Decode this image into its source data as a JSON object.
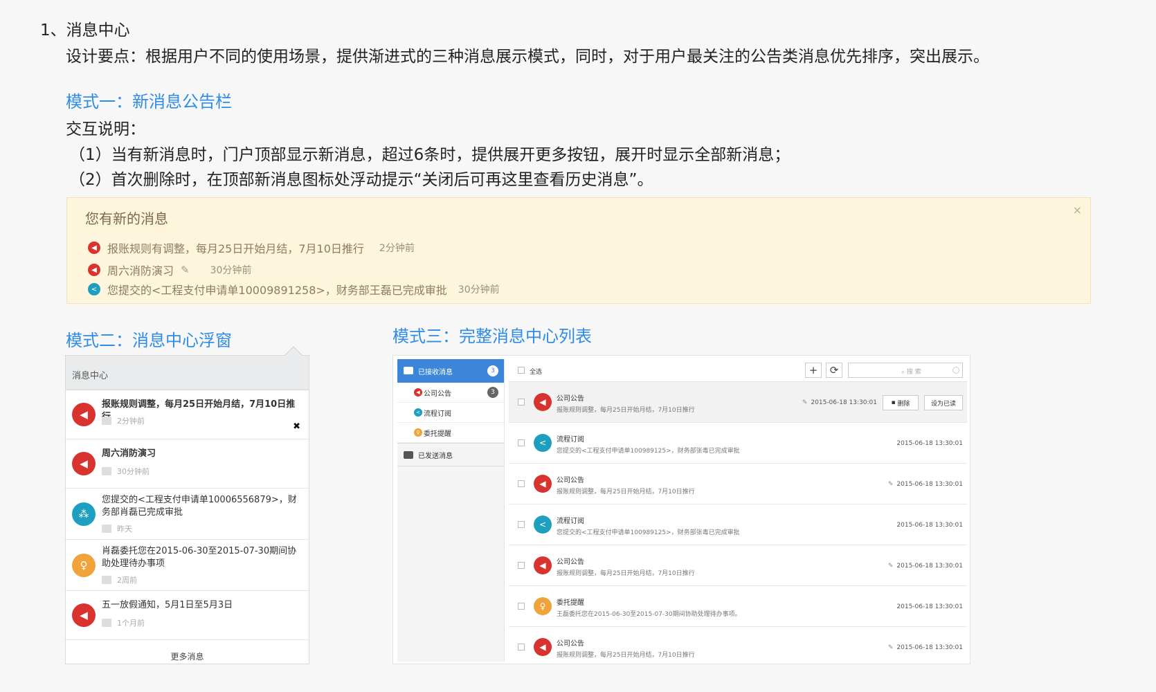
{
  "heading": "1、消息中心",
  "design_note": "设计要点：根据用户不同的使用场景，提供渐进式的三种消息展示模式，同时，对于用户最关注的公告类消息优先排序，突出展示。",
  "mode1": {
    "title": "模式一：新消息公告栏",
    "interaction_title": "交互说明：",
    "interaction_lines": [
      "（1）当有新消息时，门户顶部显示新消息，超过6条时，提供展开更多按钮，展开时显示全部新消息；",
      "（2）首次删除时，在顶部新消息图标处浮动提示“关闭后可再这里查看历史消息”。"
    ],
    "notice": {
      "title": "您有新的消息",
      "close": "×",
      "items": [
        {
          "icon": "megaphone-icon",
          "text": "报账规则有调整，每月25日开始月结，7月10日推行",
          "time": "2分钟前"
        },
        {
          "icon": "megaphone-icon",
          "text": "周六消防演习",
          "time": "30分钟前",
          "attachment": "paperclip-icon"
        },
        {
          "icon": "share-icon",
          "text": "您提交的<工程支付申请单10009891258>，财务部王磊已完成审批",
          "time": "30分钟前"
        }
      ]
    }
  },
  "mode2": {
    "title": "模式二：消息中心浮窗",
    "popup": {
      "header": "消息中心",
      "close": "✖",
      "items": [
        {
          "icon": "megaphone-icon",
          "text": "报账规则调整，每月25日开始月结，7月10日推行",
          "time": "2分钟前"
        },
        {
          "icon": "megaphone-icon",
          "text": "周六消防演习",
          "time": "30分钟前"
        },
        {
          "icon": "workflow-icon",
          "text": "您提交的<工程支付申请单10006556879>，财务部肖磊已完成审批",
          "time": "昨天"
        },
        {
          "icon": "delegate-icon",
          "text": "肖磊委托您在2015-06-30至2015-07-30期间协助处理待办事项",
          "time": "2周前"
        },
        {
          "icon": "megaphone-icon",
          "text": "五一放假通知，5月1日至5月3日",
          "time": "1个月前"
        }
      ],
      "more": "更多消息"
    }
  },
  "mode3": {
    "title": "模式三：完整消息中心列表",
    "sidebar": {
      "inbox_label": "已接收消息",
      "inbox_count": "3",
      "sub_items": [
        {
          "label": "公司公告",
          "count": "3",
          "icon": "megaphone-icon"
        },
        {
          "label": "流程订阅",
          "count": "",
          "icon": "share-icon"
        },
        {
          "label": "委托提醒",
          "count": "",
          "icon": "delegate-icon"
        }
      ],
      "sent_label": "已发送消息"
    },
    "toolbar": {
      "select_all": "全选",
      "add": "+",
      "refresh": "⟳",
      "search_placeholder": "搜 索"
    },
    "rows": [
      {
        "category": "公司公告",
        "summary": "报账规则调整，每月25日开始月结，7月10日推行",
        "date": "2015-06-18 13:30:01",
        "attachment": true,
        "icon": "megaphone-icon",
        "selected": true,
        "actions": [
          "删除",
          "设为已读"
        ]
      },
      {
        "category": "流程订阅",
        "summary": "您提交的<工程支付申请单100989125>，财务部张毒已完成审批",
        "date": "2015-06-18 13:30:01",
        "attachment": false,
        "icon": "share-icon",
        "selected": false,
        "actions": []
      },
      {
        "category": "公司公告",
        "summary": "报账规则调整，每月25日开始月结，7月10日推行",
        "date": "2015-06-18 13:30:01",
        "attachment": true,
        "icon": "megaphone-icon",
        "selected": false,
        "actions": []
      },
      {
        "category": "流程订阅",
        "summary": "您提交的<工程支付申请单100989125>，财务部张毒已完成审批",
        "date": "2015-06-18 13:30:01",
        "attachment": false,
        "icon": "share-icon",
        "selected": false,
        "actions": []
      },
      {
        "category": "公司公告",
        "summary": "报账规则调整，每月25日开始月结，7月10日推行",
        "date": "2015-06-18 13:30:01",
        "attachment": true,
        "icon": "megaphone-icon",
        "selected": false,
        "actions": []
      },
      {
        "category": "委托提醒",
        "summary": "王磊委托您在2015-06-30至2015-07-30期间协助处理待办事项。",
        "date": "2015-06-18 13:30:01",
        "attachment": false,
        "icon": "delegate-icon",
        "selected": false,
        "actions": []
      },
      {
        "category": "公司公告",
        "summary": "报账规则调整，每月25日开始月结，7月10日推行",
        "date": "2015-06-18 13:30:01",
        "attachment": true,
        "icon": "megaphone-icon",
        "selected": false,
        "actions": []
      }
    ]
  },
  "colors": {
    "accent_blue": "#2e8ce8",
    "alert_red": "#d9332f",
    "workflow_teal": "#1e9fbf",
    "delegate_orange": "#f0a33a",
    "notice_bg": "#fdf5dc"
  }
}
